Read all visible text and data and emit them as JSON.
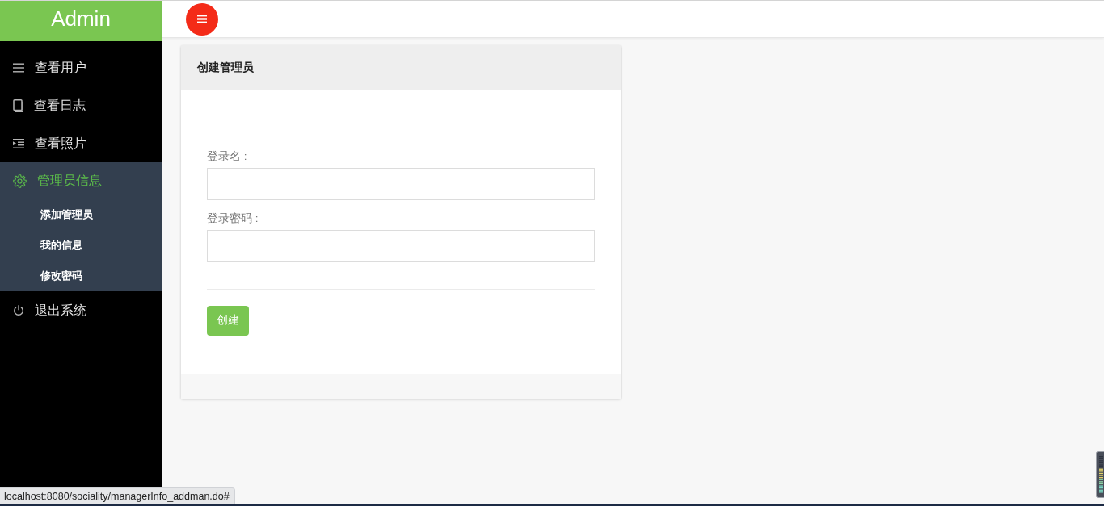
{
  "sidebar": {
    "brand": "Admin",
    "items": [
      {
        "label": "查看用户",
        "selected": false
      },
      {
        "label": "查看日志",
        "selected": false
      },
      {
        "label": "查看照片",
        "selected": false
      },
      {
        "label": "管理员信息",
        "selected": true,
        "expanded": true,
        "children": [
          {
            "label": "添加管理员",
            "selected": false
          },
          {
            "label": "我的信息",
            "selected": false
          },
          {
            "label": "修改密码",
            "selected": false
          }
        ]
      },
      {
        "label": "退出系统",
        "selected": false
      }
    ]
  },
  "form_card": {
    "title": "创建管理员",
    "fields": [
      {
        "label": "登录名 :"
      },
      {
        "label": "登录密码 :"
      }
    ],
    "submit_button": "创建"
  },
  "status_bar": {
    "url": "localhost:8080/sociality/managerInfo_addman.do#"
  }
}
